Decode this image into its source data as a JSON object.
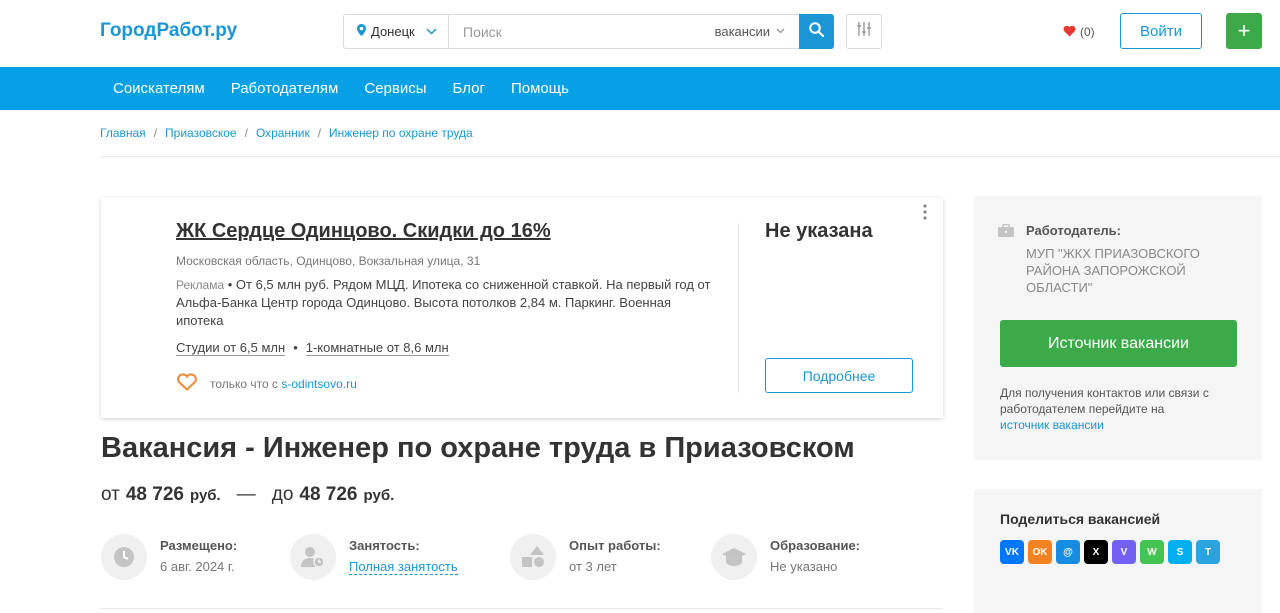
{
  "header": {
    "logo": "ГородРабот.ру",
    "city": "Донецк",
    "search_placeholder": "Поиск",
    "search_type": "вакансии",
    "favorites_count": "(0)",
    "login_label": "Войти",
    "add_label": "+"
  },
  "nav": [
    "Соискателям",
    "Работодателям",
    "Сервисы",
    "Блог",
    "Помощь"
  ],
  "breadcrumb": [
    "Главная",
    "Приазовское",
    "Охранник",
    "Инженер по охране труда"
  ],
  "ad": {
    "title": "ЖК Сердце Одинцово. Скидки до 16%",
    "address": "Московская область, Одинцово, Вокзальная улица, 31",
    "label": "Реклама",
    "description": " • От 6,5 млн руб. Рядом МЦД. Ипотека со сниженной ставкой. На первый год от Альфа-Банка Центр города Одинцово. Высота потолков 2,84 м. Паркинг. Военная ипотека",
    "link1": "Студии от 6,5 млн",
    "link2": "1-комнатные от 8,6 млн",
    "source_prefix": "только что с",
    "source_domain": "s-odintsovo.ru",
    "price": "Не указана",
    "more_label": "Подробнее"
  },
  "vacancy": {
    "title": "Вакансия - Инженер по охране труда в Приазовском",
    "salary_from_prefix": "от",
    "salary_from": "48 726",
    "salary_to_prefix": "до",
    "salary_to": "48 726",
    "currency": "руб.",
    "separator": "—",
    "facts": [
      {
        "label": "Размещено:",
        "value": "6 авг. 2024 г."
      },
      {
        "label": "Занятость:",
        "value": "Полная занятость"
      },
      {
        "label": "Опыт работы:",
        "value": "от 3 лет"
      },
      {
        "label": "Образование:",
        "value": "Не указано"
      }
    ]
  },
  "employer": {
    "label": "Работодатель:",
    "name": "МУП \"ЖКХ ПРИАЗОВСКОГО РАЙОНА ЗАПОРОЖСКОЙ ОБЛАСТИ\"",
    "source_button": "Источник вакансии",
    "note": "Для получения контактов или связи с работодателем перейдите на",
    "note_link": "источник вакансии"
  },
  "share": {
    "title": "Поделиться вакансией",
    "icons": [
      {
        "name": "vk-icon",
        "glyph": "VK",
        "color": "#0077ff"
      },
      {
        "name": "odnoklassniki-icon",
        "glyph": "OK",
        "color": "#f58220"
      },
      {
        "name": "moimir-icon",
        "glyph": "@",
        "color": "#168de2"
      },
      {
        "name": "x-icon",
        "glyph": "X",
        "color": "#000000"
      },
      {
        "name": "viber-icon",
        "glyph": "V",
        "color": "#7360f2"
      },
      {
        "name": "whatsapp-icon",
        "glyph": "W",
        "color": "#43c553"
      },
      {
        "name": "skype-icon",
        "glyph": "S",
        "color": "#00aff0"
      },
      {
        "name": "telegram-icon",
        "glyph": "T",
        "color": "#2aa3df"
      }
    ]
  },
  "colors": {
    "brand_blue": "#1a96d4",
    "nav_blue": "#06a0e6",
    "green": "#3daa4a"
  }
}
